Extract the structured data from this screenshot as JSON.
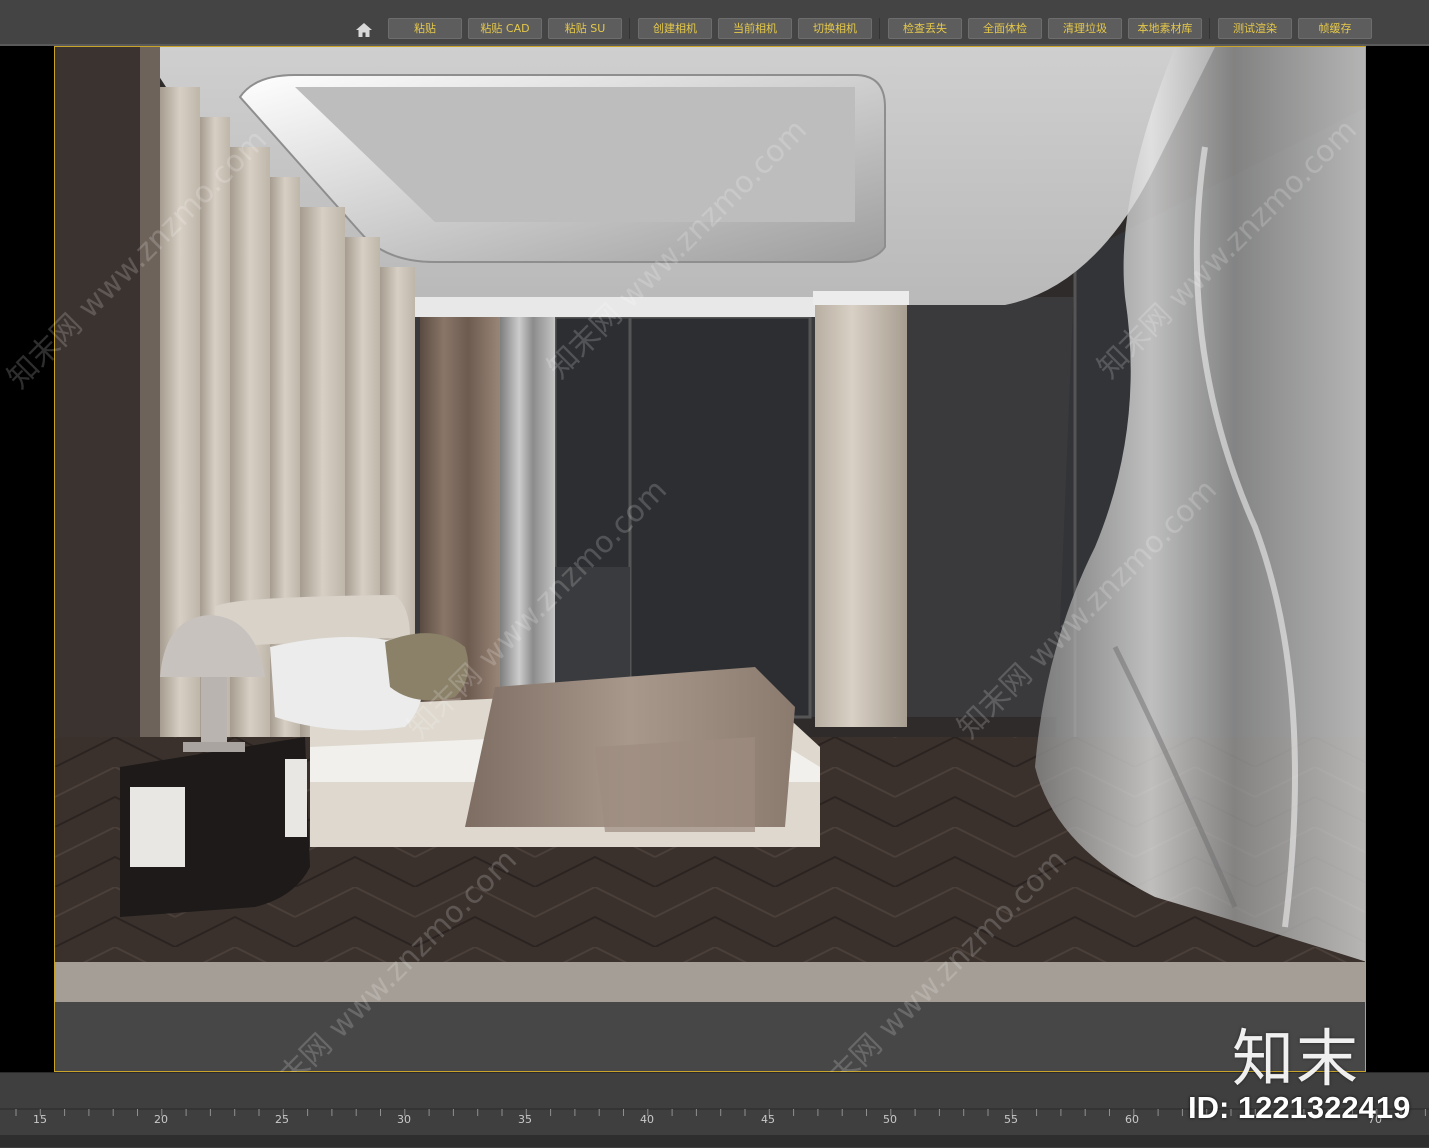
{
  "toolbar": {
    "home_icon": "home-icon",
    "accent_color": "#e5c84a",
    "buttons": [
      {
        "label": "粘贴"
      },
      {
        "label": "粘贴 CAD"
      },
      {
        "label": "粘贴 SU"
      },
      {
        "label": "创建相机"
      },
      {
        "label": "当前相机"
      },
      {
        "label": "切换相机"
      },
      {
        "label": "检查丢失"
      },
      {
        "label": "全面体检"
      },
      {
        "label": "清理垃圾"
      },
      {
        "label": "本地素材库"
      },
      {
        "label": "测试渲染"
      },
      {
        "label": "帧缓存"
      }
    ]
  },
  "viewport": {
    "frame_color": "#c8a52a",
    "scene": "bedroom-render"
  },
  "watermark": {
    "text": "知末网 www.znzmo.com"
  },
  "timeline": {
    "ticks": [
      "15",
      "20",
      "25",
      "30",
      "35",
      "40",
      "45",
      "50",
      "55",
      "60",
      "70"
    ]
  },
  "brand": {
    "logo": "知末",
    "id_text": "ID: 1221322419"
  }
}
